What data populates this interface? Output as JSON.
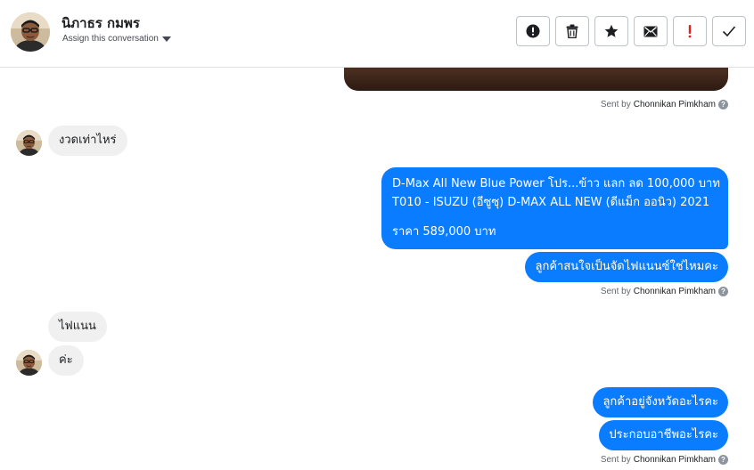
{
  "header": {
    "contact_name": "นิภาธร กมพร",
    "assign_label": "Assign this conversation"
  },
  "toolbar": {
    "buttons": [
      {
        "icon": "alert-circle-icon"
      },
      {
        "icon": "trash-icon"
      },
      {
        "icon": "star-icon"
      },
      {
        "icon": "envelope-icon"
      },
      {
        "icon": "exclamation-icon",
        "color": "#e02020"
      },
      {
        "icon": "checkmark-icon"
      }
    ]
  },
  "messages": {
    "sent_prefix": "Sent by",
    "agent_name": "Chonnikan Pimkham",
    "incoming_1": "งวดเท่าไหร่",
    "card_line_1": "D-Max All New Blue Power โปร...ข้าว แลก ลด 100,000 บาท",
    "card_line_2": "T010 - ISUZU (อีซูซุ) D-MAX ALL NEW (ดีแม็ก ออนิว) 2021",
    "card_line_3": "ราคา 589,000 บาท",
    "outgoing_1": "ลูกค้าสนใจเป็นจัดไฟแนนซ์ใช่ไหมคะ",
    "incoming_2": "ไฟแนน",
    "incoming_3": "ค่ะ",
    "outgoing_2": "ลูกค้าอยู่จังหวัดอะไรคะ",
    "outgoing_3": "ประกอบอาชีพอะไรคะ"
  },
  "colors": {
    "outgoing_bubble": "#0a7cff",
    "incoming_bubble": "#f0f0f0",
    "alert_red": "#e02020"
  }
}
